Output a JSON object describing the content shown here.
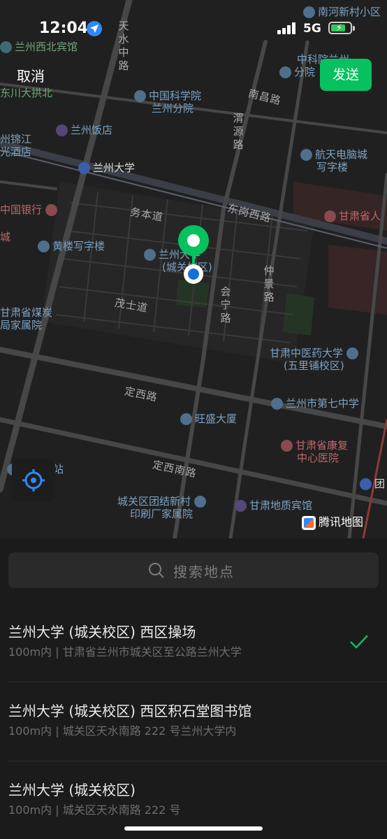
{
  "status_bar": {
    "time": "12:04",
    "network": "5G"
  },
  "header": {
    "cancel_label": "取消",
    "send_label": "发送"
  },
  "map": {
    "brand": "腾讯地图",
    "pois": {
      "xibei": "兰州西北宾馆",
      "nanhe": "南河新村小区",
      "zhongke": "中科院兰州",
      "fenyuan": "分院",
      "zky1": "中国科学院",
      "zky2": "兰州分院",
      "dongchuan": "东川大拱北",
      "fandian": "兰州饭店",
      "jinjiang1": "州锦江",
      "jinjiang2": "光酒店",
      "lzu_station": "兰州大学",
      "hangtian1": "航天电脑城",
      "hangtian2": "写字楼",
      "bank": "中国银行",
      "gansu_prov": "甘肃省人",
      "huanglou": "黄楼写字楼",
      "lzu1": "兰州大学",
      "lzu2": "(城关校区)",
      "meitan1": "甘肃省煤炭",
      "meitan2": "局家属院",
      "zhongyi1": "甘肃中医药大学",
      "zhongyi2": "(五里铺校区)",
      "middle7": "兰州市第七中学",
      "wangsheng": "旺盛大厦",
      "kangfu1": "甘肃省康复",
      "kangfu2": "中心医院",
      "bus": "路汽车站",
      "tuanjie1": "城关区团结新村",
      "tuanjie2": "印刷厂家属院",
      "dizhi": "甘肃地质宾馆",
      "tuan_edge": "团",
      "cheng_edge": "城"
    },
    "roads": {
      "tianshui": "天水中路",
      "nanchang": "南昌路",
      "weiyuan": "渭源路",
      "wuben": "务本道",
      "donggang": "东岗西路",
      "zhongjing": "仲景路",
      "huining": "会宁路",
      "maoshi": "茂士道",
      "dingxi": "定西路",
      "dingxinan": "定西南路"
    }
  },
  "search": {
    "placeholder": "搜索地点"
  },
  "results": [
    {
      "name": "兰州大学 (城关校区) 西区操场",
      "distance": "100m内",
      "address": "甘肃省兰州市城关区至公路兰州大学",
      "selected": true
    },
    {
      "name": "兰州大学 (城关校区) 西区积石堂图书馆",
      "distance": "100m内",
      "address": "城关区天水南路 222 号兰州大学内",
      "selected": false
    },
    {
      "name": "兰州大学 (城关校区)",
      "distance": "100m内",
      "address": "城关区天水南路 222 号",
      "selected": false
    }
  ],
  "colors": {
    "accent": "#07c160",
    "pin": "#07c160",
    "location": "#2f89f5"
  }
}
